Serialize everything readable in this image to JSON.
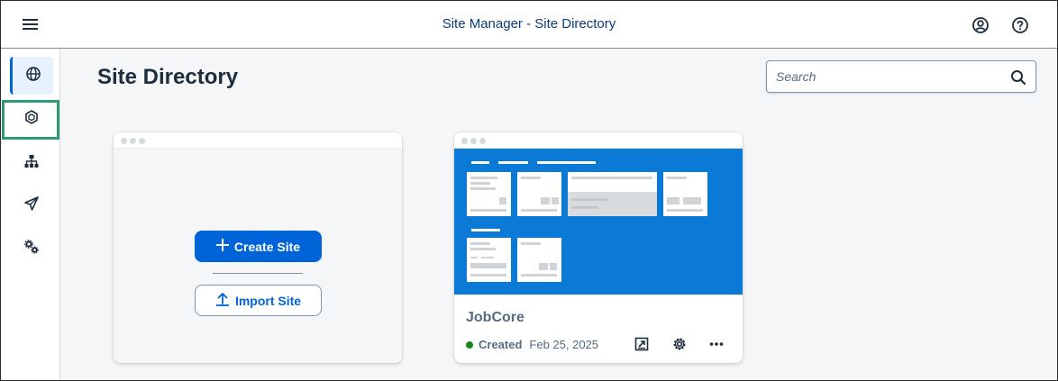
{
  "shell": {
    "title": "Site Manager - Site Directory",
    "menu_icon": "hamburger-menu-icon",
    "account_icon": "user-account-icon",
    "help_icon": "help-icon"
  },
  "sidenav": {
    "items": [
      {
        "name": "site-directory",
        "icon": "globe-icon",
        "active": true
      },
      {
        "name": "content-manager",
        "icon": "cube-icon",
        "active": false
      },
      {
        "name": "site-hierarchy",
        "icon": "hierarchy-icon",
        "active": false
      },
      {
        "name": "channel-manager",
        "icon": "paper-plane-icon",
        "active": false
      },
      {
        "name": "settings",
        "icon": "gears-icon",
        "active": false
      }
    ]
  },
  "main": {
    "title": "Site Directory",
    "search": {
      "placeholder": "Search",
      "value": ""
    }
  },
  "create_card": {
    "create_label": "Create Site",
    "import_label": "Import Site"
  },
  "site_card": {
    "name": "JobCore",
    "status": "Created",
    "date": "Feb 25, 2025",
    "actions": [
      "open-in-new-icon",
      "settings-icon",
      "more-icon"
    ]
  },
  "colors": {
    "accent": "#0064d9",
    "preview": "#0a7ad6",
    "status_success": "#188918",
    "highlight": "#2e9b78"
  }
}
